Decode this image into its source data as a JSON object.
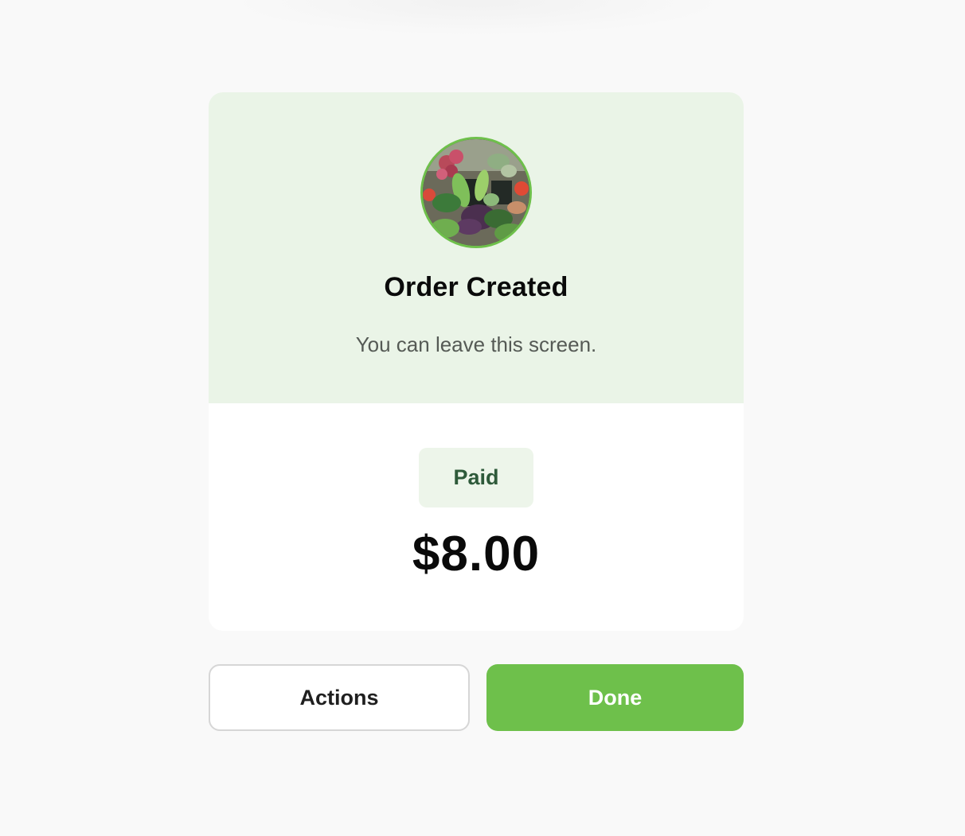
{
  "order": {
    "title": "Order Created",
    "subtitle": "You can leave this screen.",
    "avatar_icon": "produce-image",
    "status_label": "Paid",
    "amount": "$8.00"
  },
  "actions": {
    "secondary_label": "Actions",
    "primary_label": "Done"
  },
  "colors": {
    "accent": "#6ec04b",
    "header_bg": "#eaf4e7",
    "badge_text": "#2e5a3a"
  }
}
